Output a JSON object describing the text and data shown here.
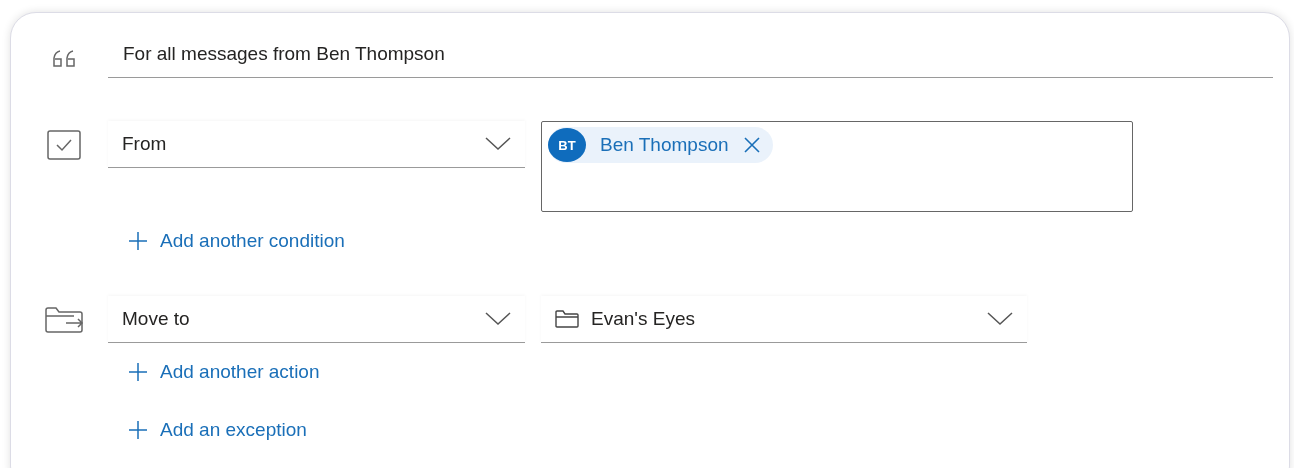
{
  "rule_name": "For all messages from Ben Thompson",
  "condition": {
    "field": "From",
    "recipients": [
      {
        "initials": "BT",
        "name": "Ben Thompson"
      }
    ]
  },
  "add_condition": "Add another condition",
  "action": {
    "field": "Move to",
    "folder": "Evan's Eyes"
  },
  "add_action": "Add another action",
  "add_exception": "Add an exception"
}
